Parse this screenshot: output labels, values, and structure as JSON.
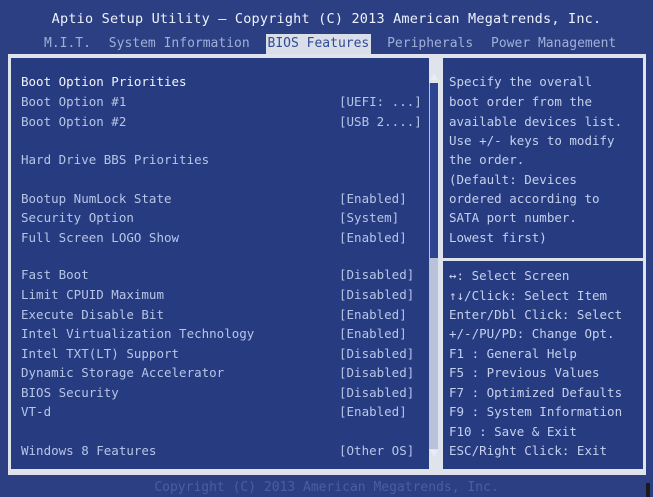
{
  "header": {
    "title": "Aptio Setup Utility – Copyright (C) 2013 American Megatrends, Inc.",
    "tabs": [
      "M.I.T.",
      "System Information",
      "BIOS Features",
      "Peripherals",
      "Power Management"
    ],
    "active_tab": "BIOS Features"
  },
  "settings": {
    "boot_option_priorities": "Boot Option Priorities",
    "boot_option_1": {
      "label": "Boot Option #1",
      "value": "[UEFI: ...]"
    },
    "boot_option_2": {
      "label": "Boot Option #2",
      "value": "[USB 2....]"
    },
    "hard_drive_bbs": "Hard Drive BBS Priorities",
    "bootup_numlock": {
      "label": "Bootup NumLock State",
      "value": "[Enabled]"
    },
    "security_option": {
      "label": "Security Option",
      "value": "[System]"
    },
    "full_screen_logo": {
      "label": "Full Screen LOGO Show",
      "value": "[Enabled]"
    },
    "fast_boot": {
      "label": "Fast Boot",
      "value": "[Disabled]"
    },
    "limit_cpuid": {
      "label": "Limit CPUID Maximum",
      "value": "[Disabled]"
    },
    "execute_disable": {
      "label": "Execute Disable Bit",
      "value": "[Enabled]"
    },
    "intel_vt": {
      "label": "Intel Virtualization Technology",
      "value": "[Enabled]"
    },
    "intel_txt": {
      "label": "Intel TXT(LT) Support",
      "value": "[Disabled]"
    },
    "dynamic_storage": {
      "label": "Dynamic Storage Accelerator",
      "value": "[Disabled]"
    },
    "bios_security": {
      "label": "BIOS Security",
      "value": "[Disabled]"
    },
    "vtd": {
      "label": "VT-d",
      "value": "[Enabled]"
    },
    "windows8": {
      "label": "Windows 8 Features",
      "value": "[Other OS]"
    }
  },
  "help": {
    "lines": [
      "Specify the overall",
      "boot order from the",
      "available devices list.",
      "Use +/- keys to modify",
      "the order.",
      "(Default: Devices",
      "ordered according to",
      "SATA port number.",
      "Lowest first)"
    ]
  },
  "keys": {
    "lines": [
      "↔: Select Screen",
      "↑↓/Click: Select Item",
      "Enter/Dbl Click: Select",
      "+/-/PU/PD: Change Opt.",
      "F1  : General Help",
      "F5  : Previous Values",
      "F7  : Optimized Defaults",
      "F9  : System Information",
      "F10 : Save & Exit",
      "ESC/Right Click: Exit"
    ]
  },
  "footer": {
    "text": "Copyright (C) 2013 American Megatrends, Inc."
  },
  "colors": {
    "background": "#2c3f83",
    "panel": "#273b80",
    "frame": "#dfe3eb",
    "active_tab": "#d9dee9"
  }
}
